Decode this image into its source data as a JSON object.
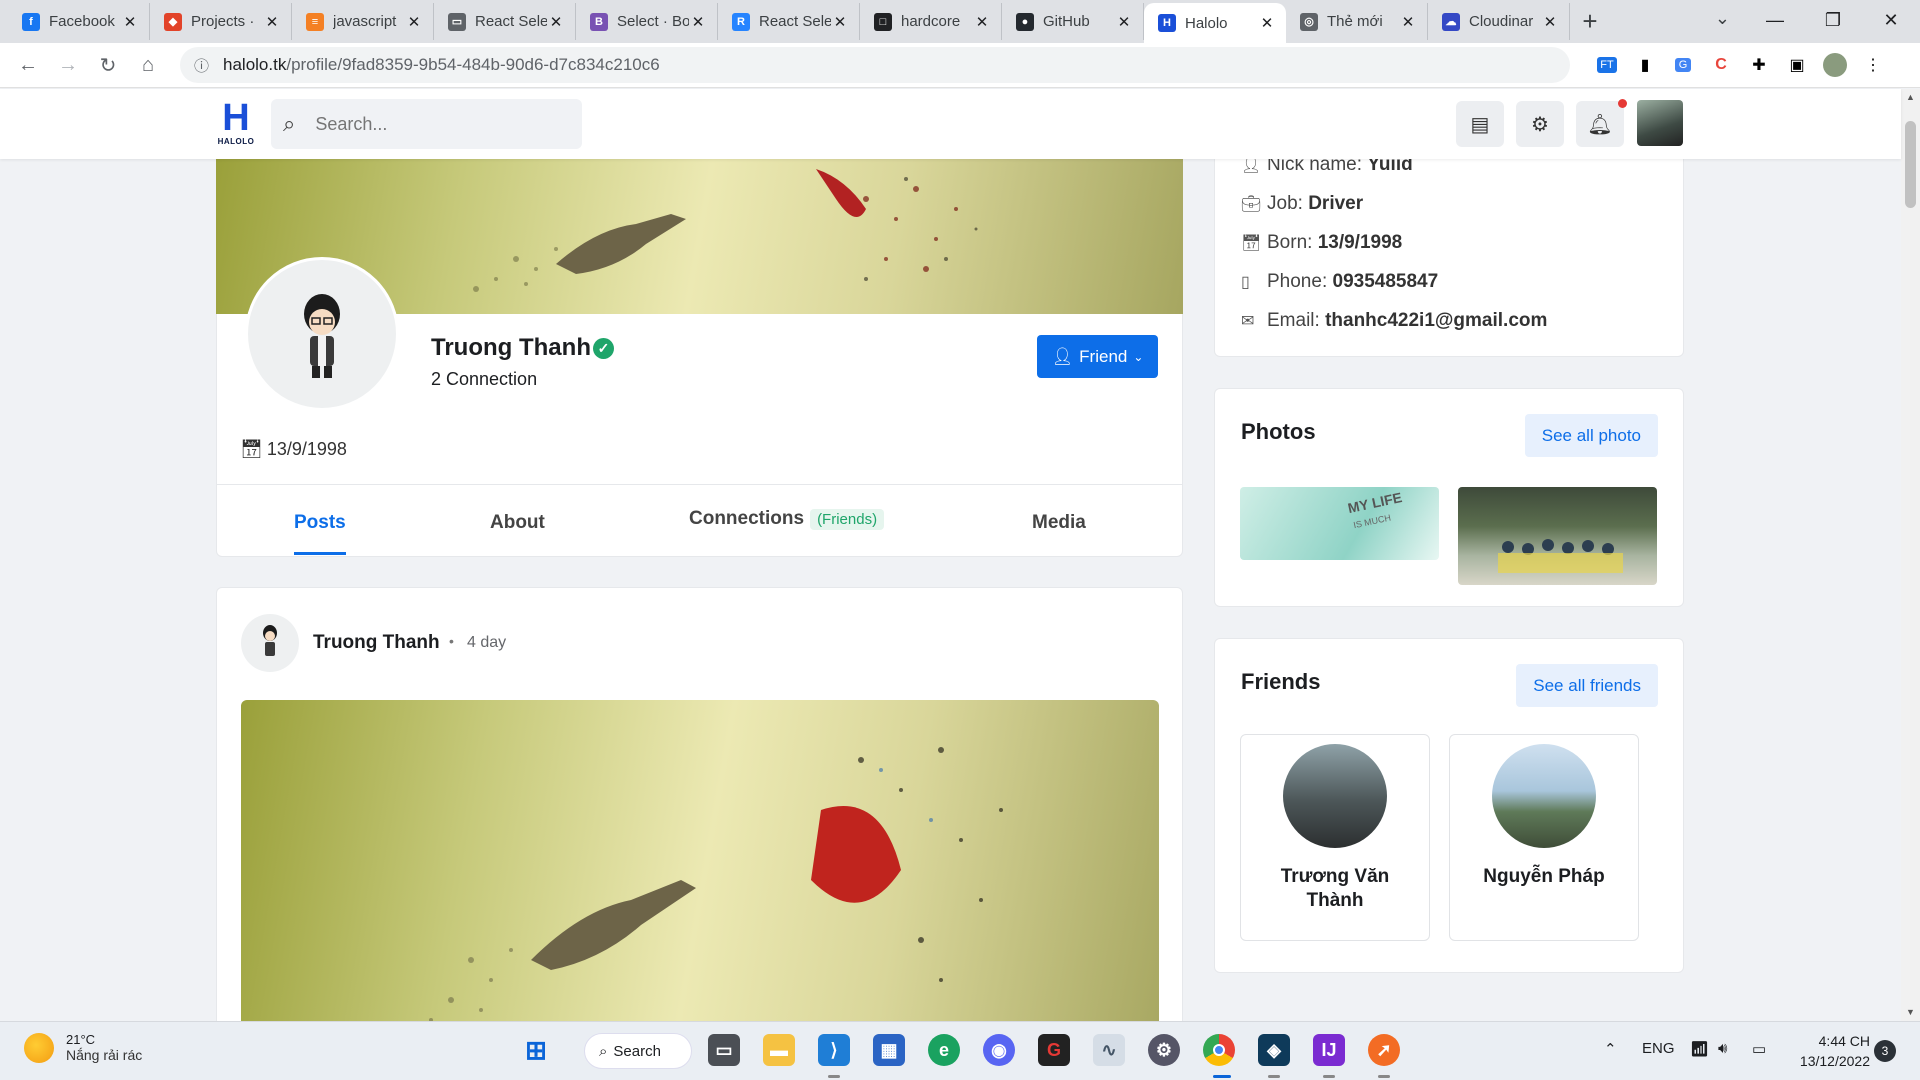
{
  "browser": {
    "tabs": [
      {
        "title": "Facebook",
        "color": "#1877f2",
        "glyph": "f"
      },
      {
        "title": "Projects ·",
        "color": "#e24329",
        "glyph": "◆"
      },
      {
        "title": "javascript",
        "color": "#f48024",
        "glyph": "≡"
      },
      {
        "title": "React Sele",
        "color": "#5f6368",
        "glyph": "▭"
      },
      {
        "title": "Select · Bo",
        "color": "#7952b3",
        "glyph": "B"
      },
      {
        "title": "React Sele",
        "color": "#2684ff",
        "glyph": "R"
      },
      {
        "title": "hardcore",
        "color": "#202124",
        "glyph": "□"
      },
      {
        "title": "GitHub",
        "color": "#24292f",
        "glyph": "●"
      },
      {
        "title": "Halolo",
        "color": "#1a4fd8",
        "glyph": "H",
        "active": true
      },
      {
        "title": "Thẻ mới",
        "color": "#5f6368",
        "glyph": "◎"
      },
      {
        "title": "Cloudinar",
        "color": "#3448c5",
        "glyph": "☁"
      }
    ],
    "url_host": "halolo.tk",
    "url_path": "/profile/9fad8359-9b54-484b-90d6-d7c834c210c6"
  },
  "app": {
    "logo_text": "HALOLO",
    "search_placeholder": "Search..."
  },
  "profile": {
    "name": "Truong Thanh",
    "connections": "2 Connection",
    "friend_button": "Friend",
    "birth": "13/9/1998",
    "tabs": {
      "posts": "Posts",
      "about": "About",
      "connections": "Connections",
      "connections_badge": "(Friends)",
      "media": "Media"
    }
  },
  "post": {
    "author": "Truong Thanh",
    "time": "4 day"
  },
  "about": {
    "nick_label": "Nick name:",
    "nick": "Yuiid",
    "job_label": "Job:",
    "job": "Driver",
    "born_label": "Born:",
    "born": "13/9/1998",
    "phone_label": "Phone:",
    "phone": "0935485847",
    "email_label": "Email:",
    "email": "thanhc422i1@gmail.com"
  },
  "photos": {
    "title": "Photos",
    "see_all": "See all photo"
  },
  "friends": {
    "title": "Friends",
    "see_all": "See all friends",
    "list": [
      {
        "name": "Trương Văn Thành"
      },
      {
        "name": "Nguyễn Pháp"
      }
    ]
  },
  "taskbar": {
    "temperature": "21°C",
    "weather": "Nắng rải rác",
    "search": "Search",
    "lang": "ENG",
    "time": "4:44 CH",
    "date": "13/12/2022",
    "notifications": "3"
  }
}
